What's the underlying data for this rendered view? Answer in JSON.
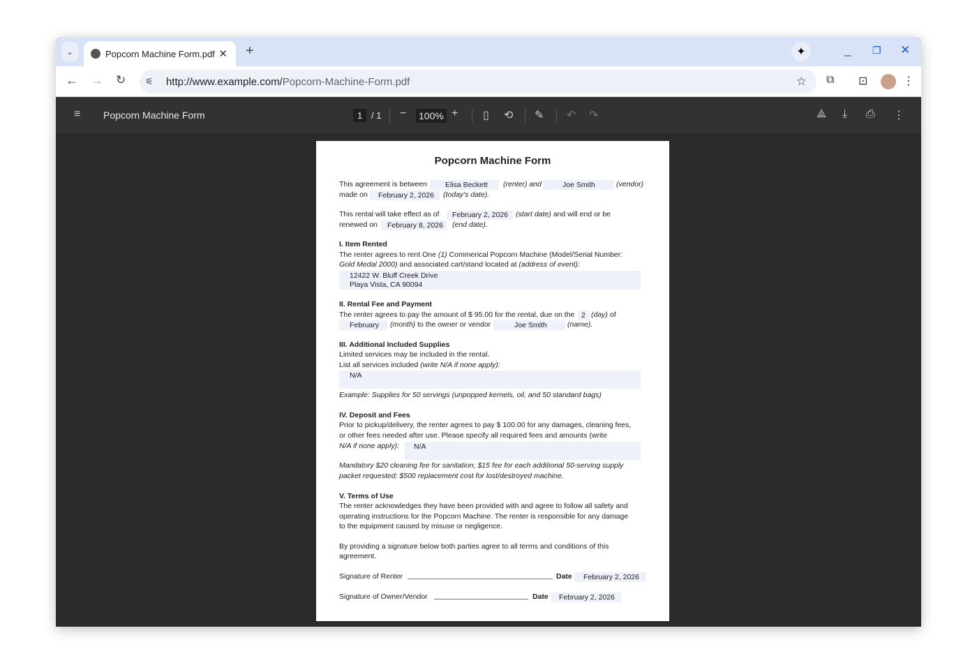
{
  "browser": {
    "tab_title": "Popcorn Machine Form.pdf",
    "url_host": "http://www.example.com/",
    "url_path": "Popcorn-Machine-Form.pdf"
  },
  "pdf_toolbar": {
    "title": "Popcorn Machine Form",
    "current_page": "1",
    "total_pages": "/ 1",
    "zoom": "100%"
  },
  "document": {
    "title": "Popcorn Machine Form",
    "intro": {
      "t1": "This agreement is between",
      "renter": "Elisa Beckett",
      "t2": "(renter) and",
      "vendor": "Joe Smith",
      "t3": "(vendor)",
      "t4": "made on",
      "today": "February 2, 2026",
      "t5": "(today's date)."
    },
    "rental": {
      "t1": "This rental will take effect as of",
      "start": "February 2, 2026",
      "t2": "(start date)",
      "t3": " and will end or be",
      "t4": "renewed on",
      "end": "February 8, 2026",
      "t5": "(end date)."
    },
    "s1": {
      "heading": "I. Item Rented",
      "l1a": "The renter agrees to rent One ",
      "l1b": "(1)",
      "l1c": " Commerical Popcorn Machine (Model/Serial Number:",
      "l2a": "Gold Medal 2000)",
      "l2b": " and associated cart/stand located at ",
      "l2c": "(address of event):",
      "address1": "12422 W. Bluff Creek Drive",
      "address2": "Playa Vista, CA 90094"
    },
    "s2": {
      "heading": "II. Rental Fee and Payment",
      "l1": "The renter agrees to pay the amount of $ 95.00 for the rental, due on the",
      "day": "2",
      "l1b": "(day)",
      "l1c": " of",
      "month": "February",
      "l2a": "(month)",
      "l2b": " to the owner or vendor",
      "name": "Joe Smith",
      "l2c": "(name)."
    },
    "s3": {
      "heading": "III. Additional Included Supplies",
      "l1": "Limited services may be included in the rental.",
      "l2a": "List all services included ",
      "l2b": "(write N/A if none apply):",
      "services": "N/A",
      "example": "Example: Supplies for 50 servings (unpopped kernels, oil, and 50 standard bags)"
    },
    "s4": {
      "heading": "IV. Deposit and Fees",
      "l1": "Prior to pickup/delivery, the renter agrees to pay $ 100.00 for any damages, cleaning fees,",
      "l2": "or other fees needed after use. Please specify all required fees and amounts (write",
      "l3": "N/A if none apply):",
      "fees": "N/A",
      "note1": "Mandatory $20 cleaning fee for sanitation; $15 fee for each additional 50-serving supply",
      "note2": "packet requested; $500 replacement cost for lost/destroyed machine."
    },
    "s5": {
      "heading": "V. Terms of Use",
      "l1": "The renter acknowledges they have been provided with and agree to follow all safety and",
      "l2": "operating instructions for the Popcorn Machine. The renter is responsible for any damage",
      "l3": "to the equipment caused by misuse or negligence.",
      "l4": "By providing a signature below both parties agree to all terms and conditions of this",
      "l5": "agreement."
    },
    "signatures": {
      "renter_label": "Signature of Renter",
      "owner_label": "Signature of Owner/Vendor",
      "date_label": "Date",
      "renter_date": "February 2, 2026",
      "owner_date": "February 2, 2026"
    }
  }
}
